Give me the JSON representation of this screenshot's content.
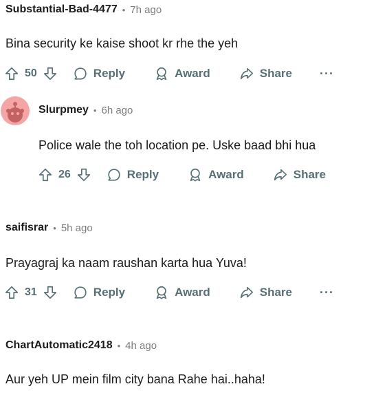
{
  "comments": [
    {
      "author": "Substantial-Bad-4477",
      "time": "7h ago",
      "text": "Bina security ke kaise shoot kr rhe the yeh",
      "votes": "50",
      "reply": "Reply",
      "award": "Award",
      "share": "Share"
    },
    {
      "author": "Slurpmey",
      "time": "6h ago",
      "text": "Police wale the toh location pe. Uske baad bhi hua",
      "votes": "26",
      "reply": "Reply",
      "award": "Award",
      "share": "Share"
    },
    {
      "author": "saifisrar",
      "time": "5h ago",
      "text": "Prayagraj ka naam raushan karta hua Yuva!",
      "votes": "31",
      "reply": "Reply",
      "award": "Award",
      "share": "Share"
    },
    {
      "author": "ChartAutomatic2418",
      "time": "4h ago",
      "text": "Aur yeh UP mein film city bana Rahe hai..haha!"
    }
  ],
  "separator": "•",
  "more_label": "···",
  "colors": {
    "meta": "#7c7c7c",
    "action": "#576f76",
    "avatar_bg": "#f4a6a6"
  },
  "icons": [
    "upvote-icon",
    "downvote-icon",
    "reply-icon",
    "award-icon",
    "share-icon",
    "more-icon",
    "snoo-avatar"
  ]
}
